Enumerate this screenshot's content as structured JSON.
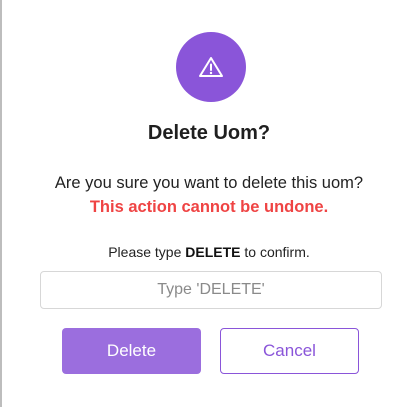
{
  "colors": {
    "accent": "#8a55d9",
    "accent_light": "#a77fe3",
    "danger": "#ef4444"
  },
  "dialog": {
    "icon": "warning-triangle-icon",
    "title": "Delete Uom?",
    "question": "Are you sure you want to delete this uom?",
    "warning": "This action cannot be undone.",
    "confirm_prefix": "Please type ",
    "confirm_keyword": "DELETE",
    "confirm_suffix": " to confirm.",
    "input": {
      "value": "",
      "placeholder": "Type 'DELETE'"
    },
    "buttons": {
      "delete_label": "Delete",
      "cancel_label": "Cancel"
    }
  }
}
